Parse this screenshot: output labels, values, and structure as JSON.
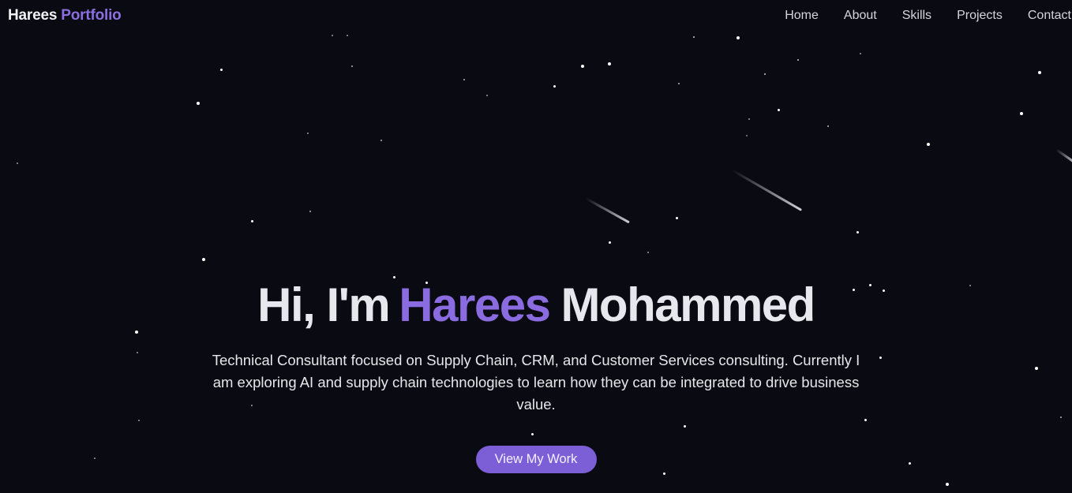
{
  "nav": {
    "brand_first": "Harees",
    "brand_second": "Portfolio",
    "links": [
      "Home",
      "About",
      "Skills",
      "Projects",
      "Contact"
    ]
  },
  "hero": {
    "title_prefix": "Hi, I'm",
    "title_accent": "Harees",
    "title_suffix": "Mohammed",
    "subtitle": "Technical Consultant focused on Supply Chain, CRM, and Customer Services consulting. Currently I am exploring AI and supply chain technologies to learn how they can be integrated to drive business value.",
    "cta_label": "View My Work"
  },
  "colors": {
    "background": "#0a0b12",
    "accent": "#8a6be0",
    "button": "#7c5fd6"
  }
}
